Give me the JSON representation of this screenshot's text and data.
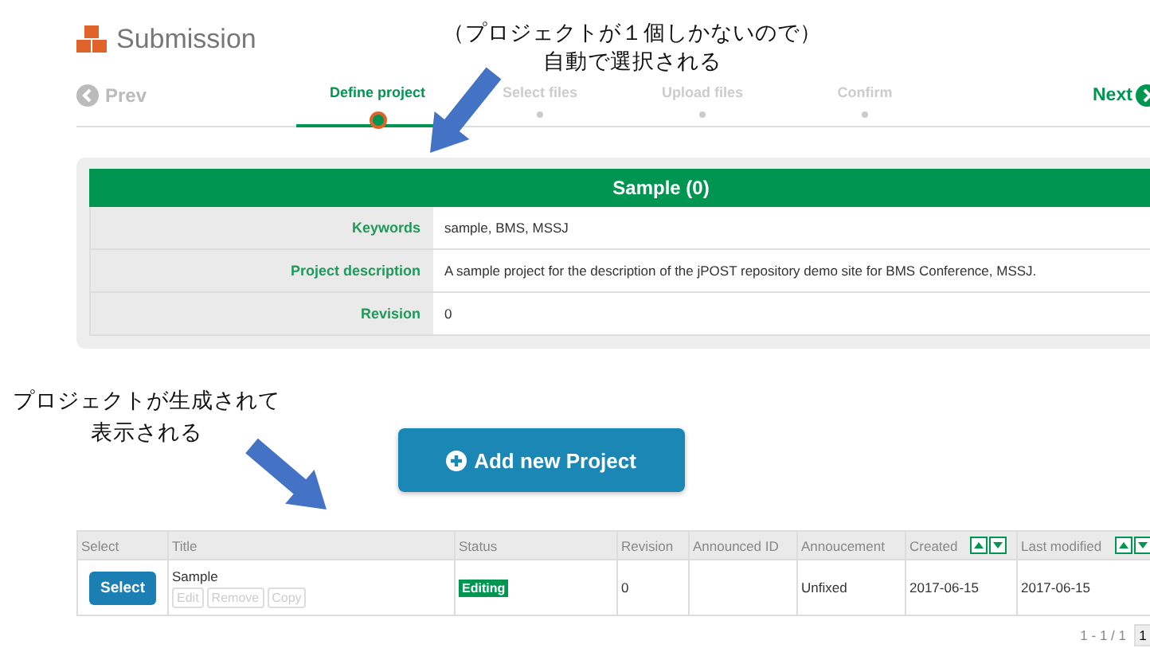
{
  "header": {
    "title": "Submission"
  },
  "wizard": {
    "prev": "Prev",
    "next": "Next",
    "steps": [
      {
        "label": "Define project",
        "selected": true
      },
      {
        "label": "Select files",
        "selected": false
      },
      {
        "label": "Upload files",
        "selected": false
      },
      {
        "label": "Confirm",
        "selected": false
      }
    ]
  },
  "project": {
    "title": "Sample (0)",
    "fields": [
      {
        "label": "Keywords",
        "value": "sample, BMS, MSSJ"
      },
      {
        "label": "Project description",
        "value": "A sample project for the description of the jPOST repository demo site for BMS Conference, MSSJ."
      },
      {
        "label": "Revision",
        "value": "0"
      }
    ]
  },
  "add_button": "Add new Project",
  "table": {
    "columns": [
      {
        "label": "Select",
        "sortable": false
      },
      {
        "label": "Title",
        "sortable": false
      },
      {
        "label": "Status",
        "sortable": false
      },
      {
        "label": "Revision",
        "sortable": false
      },
      {
        "label": "Announced ID",
        "sortable": false
      },
      {
        "label": "Annoucement",
        "sortable": false
      },
      {
        "label": "Created",
        "sortable": true
      },
      {
        "label": "Last modified",
        "sortable": true
      }
    ],
    "rows": [
      {
        "select": "Select",
        "title": "Sample",
        "actions": [
          {
            "label": "Edit",
            "disabled": true
          },
          {
            "label": "Remove",
            "disabled": true
          },
          {
            "label": "Copy",
            "disabled": true
          }
        ],
        "status": "Editing",
        "revision": "0",
        "announced_id": "",
        "announcement": "Unfixed",
        "created": "2017-06-15",
        "modified": "2017-06-15"
      }
    ]
  },
  "pagination": {
    "range": "1 - 1 / 1",
    "pages": [
      {
        "label": "1",
        "selected": true
      }
    ]
  },
  "annotations": [
    {
      "lines": [
        "（プロジェクトが１個しかないので）",
        "自動で選択される"
      ]
    },
    {
      "lines": [
        "プロジェクトが生成されて",
        "表示される"
      ]
    }
  ]
}
